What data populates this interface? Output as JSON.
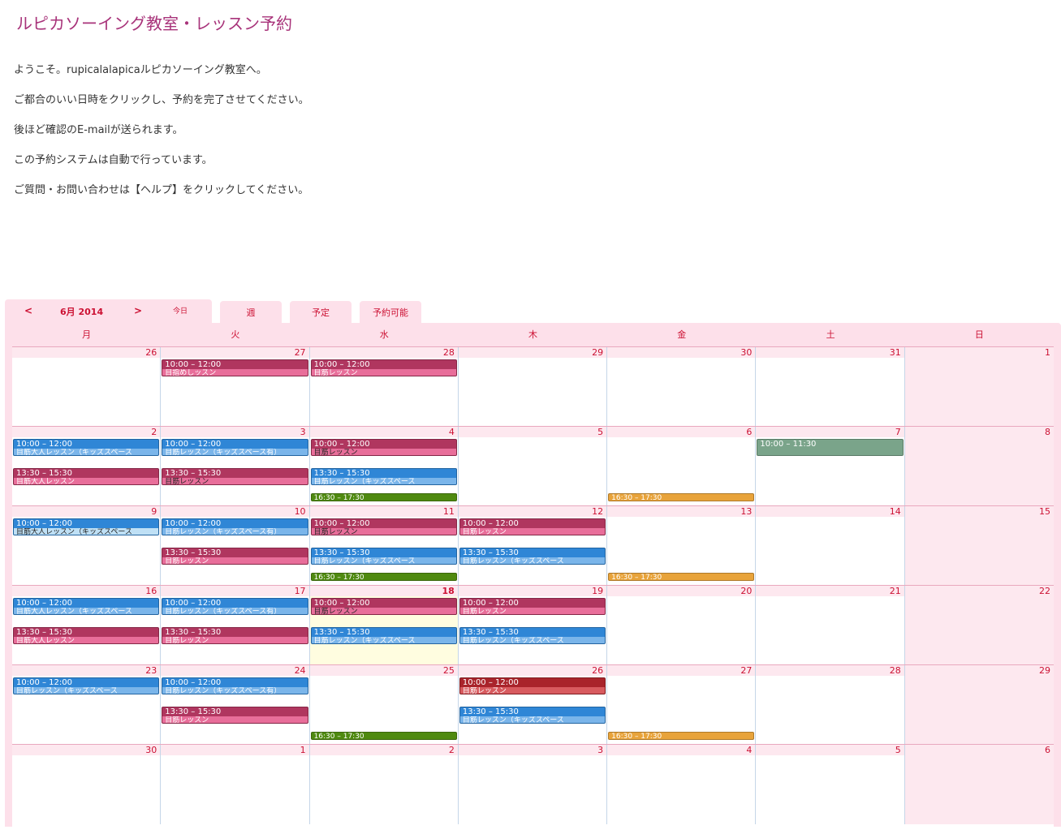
{
  "page": {
    "title": "ルピカソーイング教室・レッスン予約",
    "intro": [
      "ようこそ。rupicalalapicaルピカソーイング教室へ。",
      "ご都合のいい日時をクリックし、予約を完了させてください。",
      "後ほど確認のE-mailが送られます。",
      "この予約システムは自動で行っています。",
      "ご質問・お問い合わせは【ヘルプ】をクリックしてください。"
    ]
  },
  "calendar": {
    "prev_label": "<",
    "next_label": ">",
    "month_label": "6月 2014",
    "today_label": "今日",
    "tabs": [
      "週",
      "予定",
      "予約可能"
    ],
    "weekdays": [
      "月",
      "火",
      "水",
      "木",
      "金",
      "土",
      "日"
    ],
    "weeks": [
      [
        "26",
        "27",
        "28",
        "29",
        "30",
        "31",
        "1"
      ],
      [
        "2",
        "3",
        "4",
        "5",
        "6",
        "7",
        "8"
      ],
      [
        "9",
        "10",
        "11",
        "12",
        "13",
        "14",
        "15"
      ],
      [
        "16",
        "17",
        "18",
        "19",
        "20",
        "21",
        "22"
      ],
      [
        "23",
        "24",
        "25",
        "26",
        "27",
        "28",
        "29"
      ],
      [
        "30",
        "1",
        "2",
        "3",
        "4",
        "5",
        "6"
      ]
    ],
    "today_position": {
      "week": 3,
      "day": 2
    },
    "colors": {
      "maroon": "#b0365f",
      "maroon_light": "#e86e9a",
      "blue": "#2f86d6",
      "blue_light": "#7ab5ea",
      "green": "#4f8a10",
      "orange": "#e8a33a",
      "sage": "#7aa48a",
      "darkred": "#a9242b",
      "darkred_light": "#d85b5f"
    },
    "events": [
      {
        "week": 0,
        "day": 1,
        "slot": 0,
        "color": "maroon",
        "time": "10:00 – 12:00",
        "name": "目指めしッスン"
      },
      {
        "week": 0,
        "day": 2,
        "slot": 0,
        "color": "maroon",
        "time": "10:00 – 12:00",
        "name": "目筋レッスン"
      },
      {
        "week": 1,
        "day": 0,
        "slot": 0,
        "color": "blue",
        "time": "10:00 – 12:00",
        "name": "目筋大人レッスン（キッズスペース"
      },
      {
        "week": 1,
        "day": 1,
        "slot": 0,
        "color": "blue",
        "time": "10:00 – 12:00",
        "name": "目筋レッスン（キッズスペース有）"
      },
      {
        "week": 1,
        "day": 2,
        "slot": 0,
        "color": "maroon",
        "style": "hatched",
        "time": "10:00 – 12:00",
        "name": "目筋レッスン"
      },
      {
        "week": 1,
        "day": 5,
        "slot": 0,
        "color": "sage",
        "time": "10:00 – 11:30",
        "name": ""
      },
      {
        "week": 1,
        "day": 0,
        "slot": 1,
        "color": "maroon",
        "time": "13:30 – 15:30",
        "name": "目筋大人レッスン"
      },
      {
        "week": 1,
        "day": 1,
        "slot": 1,
        "color": "maroon",
        "style": "hatched",
        "time": "13:30 – 15:30",
        "name": "目筋レッスン"
      },
      {
        "week": 1,
        "day": 2,
        "slot": 1,
        "color": "blue",
        "time": "13:30 – 15:30",
        "name": "目筋レッスン（キッズスペース"
      },
      {
        "week": 1,
        "day": 2,
        "slot": 2,
        "color": "green",
        "time": "16:30 – 17:30",
        "name": ""
      },
      {
        "week": 1,
        "day": 4,
        "slot": 2,
        "color": "orange",
        "time": "16:30 – 17:30",
        "name": ""
      },
      {
        "week": 2,
        "day": 0,
        "slot": 0,
        "color": "blue",
        "style": "lightblue",
        "time": "10:00 – 12:00",
        "name": "目筋大人レッスン（キッズスペース"
      },
      {
        "week": 2,
        "day": 1,
        "slot": 0,
        "color": "blue",
        "time": "10:00 – 12:00",
        "name": "目筋レッスン（キッズスペース有）"
      },
      {
        "week": 2,
        "day": 2,
        "slot": 0,
        "color": "maroon",
        "style": "hatched",
        "time": "10:00 – 12:00",
        "name": "目筋レッスン"
      },
      {
        "week": 2,
        "day": 3,
        "slot": 0,
        "color": "maroon",
        "time": "10:00 – 12:00",
        "name": "目筋レッスン"
      },
      {
        "week": 2,
        "day": 1,
        "slot": 1,
        "color": "maroon",
        "time": "13:30 – 15:30",
        "name": "目筋レッスン"
      },
      {
        "week": 2,
        "day": 2,
        "slot": 1,
        "color": "blue",
        "time": "13:30 – 15:30",
        "name": "目筋レッスン（キッズスペース"
      },
      {
        "week": 2,
        "day": 3,
        "slot": 1,
        "color": "blue",
        "time": "13:30 – 15:30",
        "name": "目筋レッスン（キッズスペース"
      },
      {
        "week": 2,
        "day": 2,
        "slot": 2,
        "color": "green",
        "time": "16:30 – 17:30",
        "name": ""
      },
      {
        "week": 2,
        "day": 4,
        "slot": 2,
        "color": "orange",
        "time": "16:30 – 17:30",
        "name": ""
      },
      {
        "week": 3,
        "day": 0,
        "slot": 0,
        "color": "blue",
        "time": "10:00 – 12:00",
        "name": "目筋大人レッスン（キッズスペース"
      },
      {
        "week": 3,
        "day": 1,
        "slot": 0,
        "color": "blue",
        "time": "10:00 – 12:00",
        "name": "目筋レッスン（キッズスペース有）"
      },
      {
        "week": 3,
        "day": 2,
        "slot": 0,
        "color": "maroon",
        "style": "hatched",
        "time": "10:00 – 12:00",
        "name": "目筋レッスン"
      },
      {
        "week": 3,
        "day": 3,
        "slot": 0,
        "color": "maroon",
        "time": "10:00 – 12:00",
        "name": "目筋レッスン"
      },
      {
        "week": 3,
        "day": 0,
        "slot": 1,
        "color": "maroon",
        "time": "13:30 – 15:30",
        "name": "目筋大人レッスン"
      },
      {
        "week": 3,
        "day": 1,
        "slot": 1,
        "color": "maroon",
        "time": "13:30 – 15:30",
        "name": "目筋レッスン"
      },
      {
        "week": 3,
        "day": 2,
        "slot": 1,
        "color": "blue",
        "time": "13:30 – 15:30",
        "name": "目筋レッスン（キッズスペース"
      },
      {
        "week": 3,
        "day": 3,
        "slot": 1,
        "color": "blue",
        "time": "13:30 – 15:30",
        "name": "目筋レッスン（キッズスペース"
      },
      {
        "week": 4,
        "day": 0,
        "slot": 0,
        "color": "blue",
        "time": "10:00 – 12:00",
        "name": "目筋レッスン（キッズスペース"
      },
      {
        "week": 4,
        "day": 1,
        "slot": 0,
        "color": "blue",
        "time": "10:00 – 12:00",
        "name": "目筋レッスン（キッズスペース有）"
      },
      {
        "week": 4,
        "day": 3,
        "slot": 0,
        "color": "darkred",
        "time": "10:00 – 12:00",
        "name": "目筋レッスン"
      },
      {
        "week": 4,
        "day": 1,
        "slot": 1,
        "color": "maroon",
        "time": "13:30 – 15:30",
        "name": "目筋レッスン"
      },
      {
        "week": 4,
        "day": 3,
        "slot": 1,
        "color": "blue",
        "time": "13:30 – 15:30",
        "name": "目筋レッスン（キッズスペース"
      },
      {
        "week": 4,
        "day": 2,
        "slot": 2,
        "color": "green",
        "time": "16:30 – 17:30",
        "name": ""
      },
      {
        "week": 4,
        "day": 4,
        "slot": 2,
        "color": "orange",
        "time": "16:30 – 17:30",
        "name": ""
      }
    ]
  }
}
